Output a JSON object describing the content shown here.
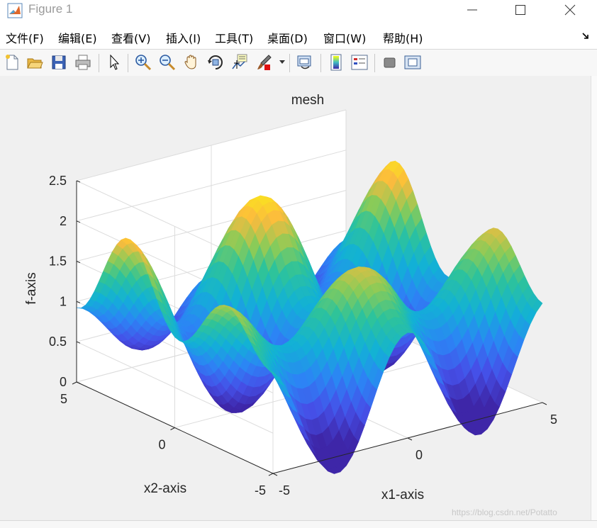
{
  "window": {
    "title": "Figure 1"
  },
  "menu": [
    {
      "label": "文件(F)"
    },
    {
      "label": "编辑(E)"
    },
    {
      "label": "查看(V)"
    },
    {
      "label": "插入(I)"
    },
    {
      "label": "工具(T)"
    },
    {
      "label": "桌面(D)"
    },
    {
      "label": "窗口(W)"
    },
    {
      "label": "帮助(H)"
    }
  ],
  "toolbar_icons": [
    "new-figure-icon",
    "open-file-icon",
    "save-icon",
    "print-icon",
    "edit-plot-icon",
    "zoom-in-icon",
    "zoom-out-icon",
    "pan-icon",
    "rotate-3d-icon",
    "data-cursor-icon",
    "brush-icon",
    "link-plot-icon",
    "insert-colorbar-icon",
    "insert-legend-icon",
    "hide-plot-tools-icon",
    "show-plot-tools-icon"
  ],
  "chart_data": {
    "type": "surface",
    "title": "mesh",
    "xlabel": "x1-axis",
    "ylabel": "x2-axis",
    "zlabel": "f-axis",
    "xlim": [
      -5,
      5
    ],
    "ylim": [
      -5,
      5
    ],
    "zlim": [
      0,
      2.5
    ],
    "x_ticks": [
      "-5",
      "0",
      "5"
    ],
    "y_ticks": [
      "-5",
      "0",
      "5"
    ],
    "z_ticks": [
      "0",
      "0.5",
      "1",
      "1.5",
      "2",
      "2.5"
    ],
    "colormap": "parula",
    "grid": true,
    "view": {
      "azimuth": -37.5,
      "elevation": 30
    }
  },
  "watermark": "https://blog.csdn.net/Potatto"
}
